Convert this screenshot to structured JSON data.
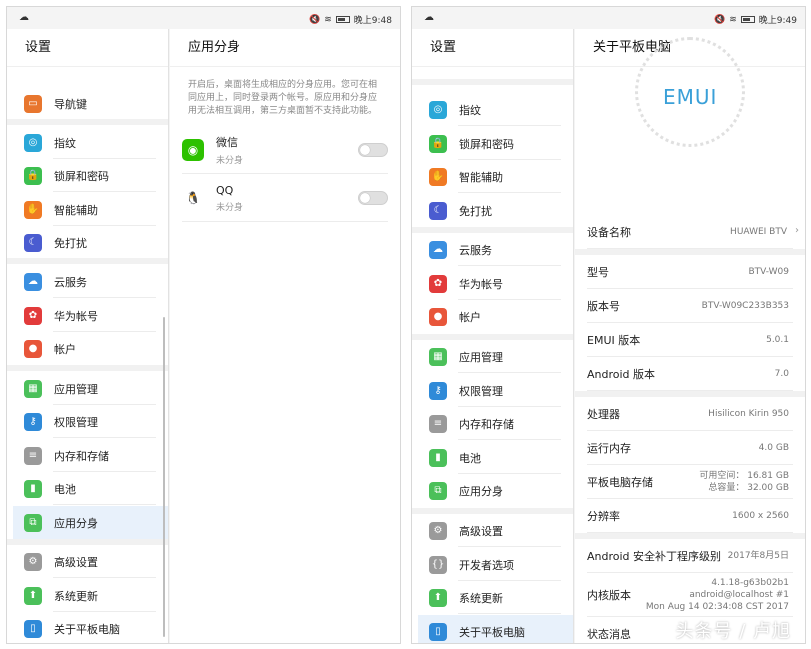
{
  "left": {
    "status": {
      "time": "晚上9:48"
    },
    "settings_title": "设置",
    "list": [
      {
        "label": "导航键",
        "icon": "navigation-key-icon",
        "color": "#e8762e"
      },
      {
        "label": "指纹",
        "icon": "fingerprint-icon",
        "color": "#2aa7d8"
      },
      {
        "label": "锁屏和密码",
        "icon": "lock-icon",
        "color": "#3cbf4f"
      },
      {
        "label": "智能辅助",
        "icon": "hand-icon",
        "color": "#f07a24"
      },
      {
        "label": "免打扰",
        "icon": "moon-icon",
        "color": "#4a5cd0"
      },
      {
        "label": "云服务",
        "icon": "cloud-icon",
        "color": "#3a8fe0"
      },
      {
        "label": "华为帐号",
        "icon": "huawei-icon",
        "color": "#e23b3b"
      },
      {
        "label": "帐户",
        "icon": "account-icon",
        "color": "#e8563a"
      },
      {
        "label": "应用管理",
        "icon": "apps-icon",
        "color": "#4bc05a"
      },
      {
        "label": "权限管理",
        "icon": "key-icon",
        "color": "#2f8ad8"
      },
      {
        "label": "内存和存储",
        "icon": "storage-icon",
        "color": "#9a9a9a"
      },
      {
        "label": "电池",
        "icon": "battery-icon",
        "color": "#4bc05a"
      },
      {
        "label": "应用分身",
        "icon": "app-twin-icon",
        "color": "#4bc05a"
      },
      {
        "label": "高级设置",
        "icon": "gear-icon",
        "color": "#9a9a9a"
      },
      {
        "label": "系统更新",
        "icon": "system-update-icon",
        "color": "#4bc05a"
      },
      {
        "label": "关于平板电脑",
        "icon": "tablet-icon",
        "color": "#2f8ad8"
      }
    ],
    "detail_title": "应用分身",
    "description": "开启后，桌面将生成相应的分身应用。您可在相同应用上，同时登录两个帐号。原应用和分身应用无法相互调用，第三方桌面暂不支持此功能。",
    "apps": [
      {
        "name": "微信",
        "status": "未分身",
        "icon": "wechat-icon",
        "color": "#2dc100"
      },
      {
        "name": "QQ",
        "status": "未分身",
        "icon": "qq-icon",
        "color": "#111111"
      }
    ]
  },
  "right": {
    "status": {
      "time": "晚上9:49"
    },
    "settings_title": "设置",
    "list": [
      {
        "label": "指纹",
        "icon": "fingerprint-icon",
        "color": "#2aa7d8"
      },
      {
        "label": "锁屏和密码",
        "icon": "lock-icon",
        "color": "#3cbf4f"
      },
      {
        "label": "智能辅助",
        "icon": "hand-icon",
        "color": "#f07a24"
      },
      {
        "label": "免打扰",
        "icon": "moon-icon",
        "color": "#4a5cd0"
      },
      {
        "label": "云服务",
        "icon": "cloud-icon",
        "color": "#3a8fe0"
      },
      {
        "label": "华为帐号",
        "icon": "huawei-icon",
        "color": "#e23b3b"
      },
      {
        "label": "帐户",
        "icon": "account-icon",
        "color": "#e8563a"
      },
      {
        "label": "应用管理",
        "icon": "apps-icon",
        "color": "#4bc05a"
      },
      {
        "label": "权限管理",
        "icon": "key-icon",
        "color": "#2f8ad8"
      },
      {
        "label": "内存和存储",
        "icon": "storage-icon",
        "color": "#9a9a9a"
      },
      {
        "label": "电池",
        "icon": "battery-icon",
        "color": "#4bc05a"
      },
      {
        "label": "应用分身",
        "icon": "app-twin-icon",
        "color": "#4bc05a"
      },
      {
        "label": "高级设置",
        "icon": "gear-icon",
        "color": "#9a9a9a"
      },
      {
        "label": "开发者选项",
        "icon": "developer-icon",
        "color": "#9a9a9a"
      },
      {
        "label": "系统更新",
        "icon": "system-update-icon",
        "color": "#4bc05a"
      },
      {
        "label": "关于平板电脑",
        "icon": "tablet-icon",
        "color": "#2f8ad8"
      }
    ],
    "detail_title": "关于平板电脑",
    "logo": "EMUI",
    "rows": [
      {
        "key": "设备名称",
        "value": "HUAWEI BTV"
      },
      {
        "key": "型号",
        "value": "BTV-W09"
      },
      {
        "key": "版本号",
        "value": "BTV-W09C233B353"
      },
      {
        "key": "EMUI 版本",
        "value": "5.0.1"
      },
      {
        "key": "Android 版本",
        "value": "7.0"
      },
      {
        "key": "处理器",
        "value": "Hisilicon Kirin 950"
      },
      {
        "key": "运行内存",
        "value": "4.0 GB"
      },
      {
        "key": "平板电脑存储",
        "value": "可用空间： 16.81 GB",
        "value2": "总容量： 32.00 GB"
      },
      {
        "key": "分辨率",
        "value": "1600 x 2560"
      },
      {
        "key": "Android 安全补丁程序级别",
        "value": "2017年8月5日"
      },
      {
        "key": "内核版本",
        "value": "4.1.18-g63b02b1",
        "value2": "android@localhost #1",
        "value3": "Mon Aug 14 02:34:08 CST 2017"
      },
      {
        "key": "状态消息",
        "value": ""
      }
    ]
  },
  "watermark": "头条号 / 卢旭"
}
